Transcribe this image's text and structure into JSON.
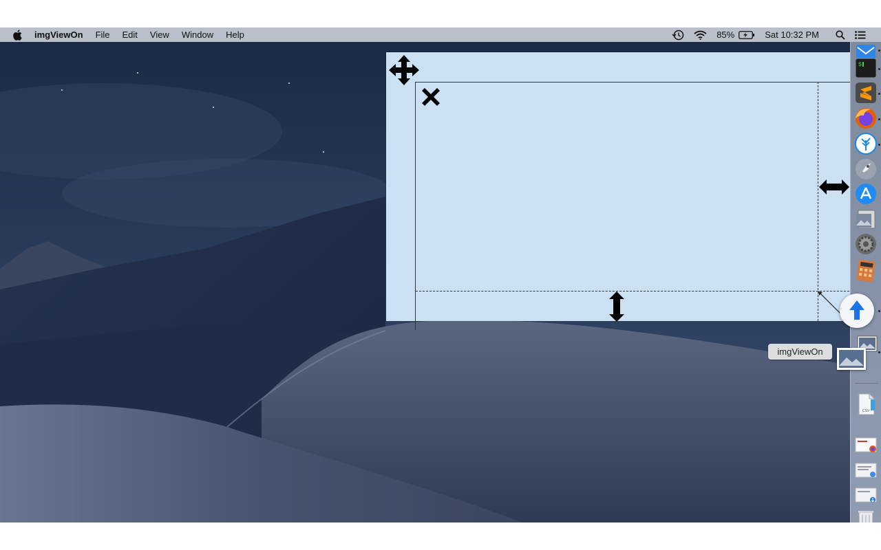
{
  "menubar": {
    "app_name": "imgViewOn",
    "items": [
      "File",
      "Edit",
      "View",
      "Window",
      "Help"
    ],
    "status": {
      "battery": "85%",
      "clock": "Sat 10:32 PM"
    }
  },
  "app_window": {
    "background": "#cce0f3",
    "controls": [
      "move-icon",
      "close-icon",
      "resize-horizontal-icon",
      "resize-vertical-icon",
      "resize-diagonal-icon"
    ]
  },
  "dock": {
    "tooltip": "imgViewOn",
    "apps": [
      "mail-icon",
      "terminal-icon",
      "sublime-text-icon",
      "firefox-icon",
      "vscode-icon",
      "launchpad-icon",
      "app-store-icon",
      "preview-icon",
      "system-preferences-icon",
      "calculator-icon",
      "imgviewon-icon"
    ],
    "documents": [
      "csv-file-icon",
      "firefox-document-icon",
      "screenshot-document-icon",
      "image-document-icon",
      "trash-icon"
    ]
  }
}
